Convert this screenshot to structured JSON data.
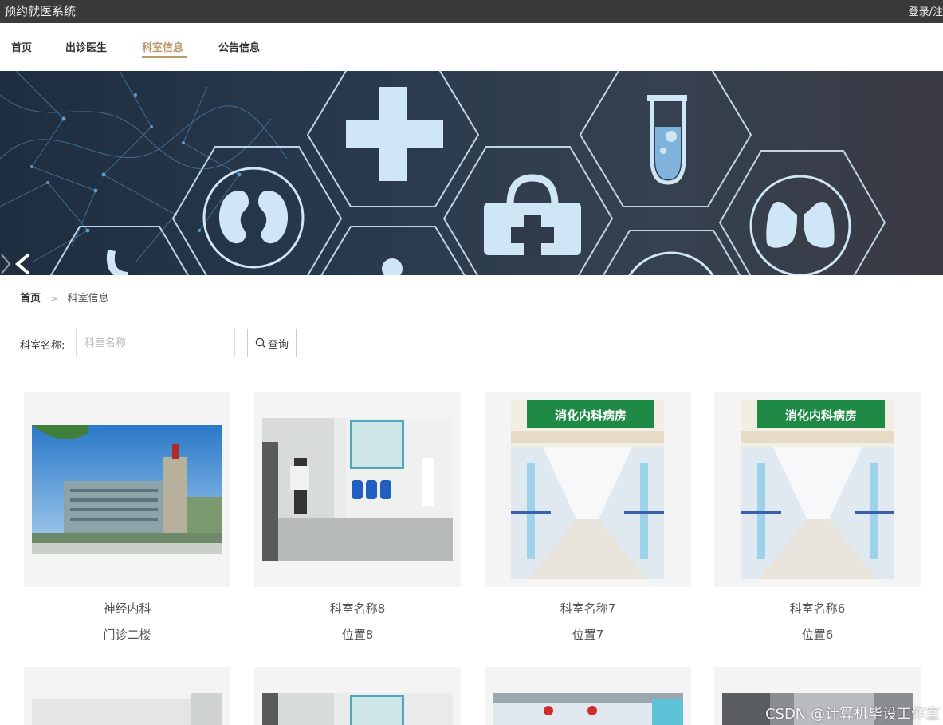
{
  "topbar": {
    "site_title": "预约就医系统",
    "login_link": "登录/注"
  },
  "nav": {
    "items": [
      "首页",
      "出诊医生",
      "科室信息",
      "公告信息"
    ],
    "active_index": 2
  },
  "breadcrumb": {
    "home": "首页",
    "separator": ">",
    "current": "科室信息"
  },
  "search": {
    "label": "科室名称:",
    "placeholder": "科室名称",
    "value": "",
    "button_label": "查询",
    "button_icon": "search-icon"
  },
  "cards": [
    {
      "name": "神经内科",
      "location": "门诊二楼"
    },
    {
      "name": "科室名称8",
      "location": "位置8"
    },
    {
      "name": "科室名称7",
      "location": "位置7"
    },
    {
      "name": "科室名称6",
      "location": "位置6"
    }
  ],
  "banner_sign": "消化内科病房",
  "watermark": "CSDN @计算机毕设工作室",
  "colors": {
    "topbar": "#3a3a3a",
    "accent": "#b8996a",
    "card_bg": "#f4f4f4",
    "icon_blue": "#cfe6f7"
  }
}
